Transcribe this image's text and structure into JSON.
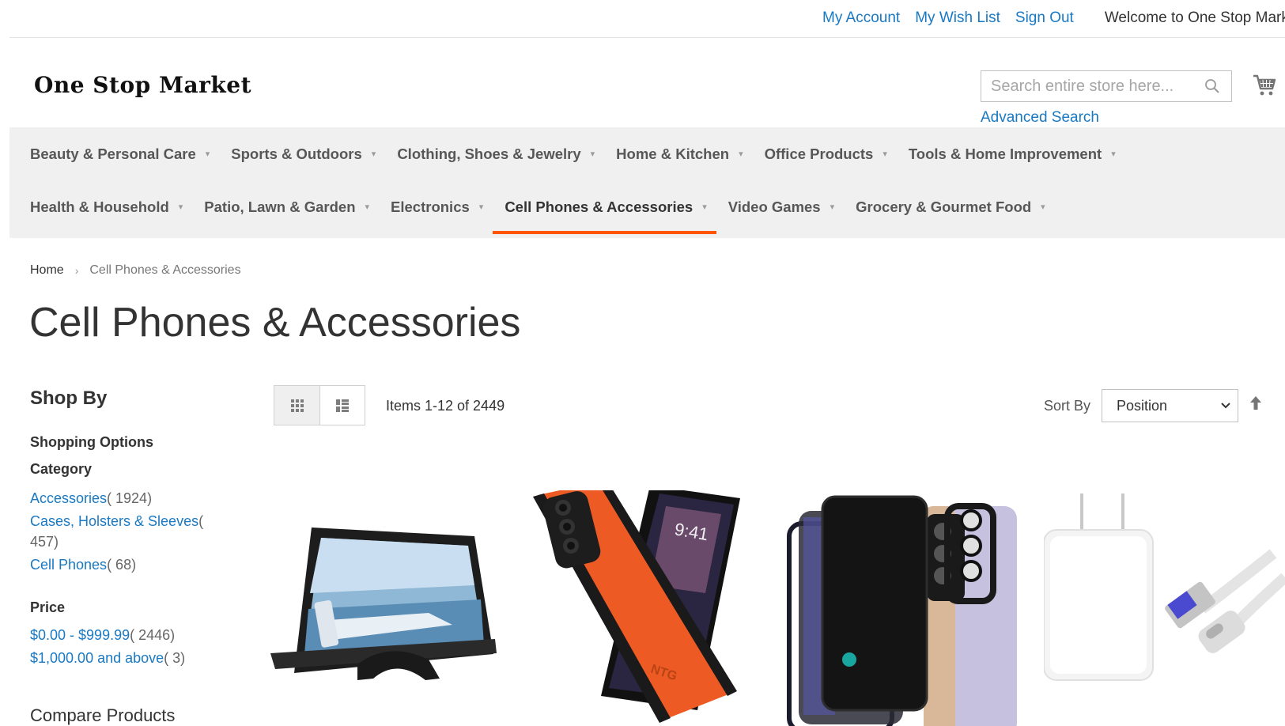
{
  "header": {
    "links": [
      "My Account",
      "My Wish List",
      "Sign Out"
    ],
    "welcome": "Welcome to One Stop Market"
  },
  "logo": "One Stop Market",
  "search": {
    "placeholder": "Search entire store here...",
    "advanced": "Advanced Search"
  },
  "nav": {
    "row1": [
      "Beauty & Personal Care",
      "Sports & Outdoors",
      "Clothing, Shoes & Jewelry",
      "Home & Kitchen",
      "Office Products",
      "Tools & Home Improvement"
    ],
    "row2": [
      "Health & Household",
      "Patio, Lawn & Garden",
      "Electronics",
      "Cell Phones & Accessories",
      "Video Games",
      "Grocery & Gourmet Food"
    ],
    "active": "Cell Phones & Accessories",
    "active_color": "#ff5501"
  },
  "breadcrumb": {
    "home": "Home",
    "current": "Cell Phones & Accessories"
  },
  "page_title": "Cell Phones & Accessories",
  "sidebar": {
    "shop_by": "Shop By",
    "shopping_options": "Shopping Options",
    "category_title": "Category",
    "categories": [
      {
        "label": "Accessories",
        "count": "( 1924)"
      },
      {
        "label": "Cases, Holsters & Sleeves",
        "count": "( 457)"
      },
      {
        "label": "Cell Phones",
        "count": "( 68)"
      }
    ],
    "price_title": "Price",
    "prices": [
      {
        "label": "$0.00 - $999.99",
        "count": "( 2446)"
      },
      {
        "label": "$1,000.00 and above",
        "count": "( 3)"
      }
    ],
    "compare": "Compare Products"
  },
  "toolbar": {
    "items": "Items 1-12 of 2449",
    "sort_label": "Sort By",
    "sort_value": "Position"
  },
  "products": [
    {
      "icon": "phone-screen-magnifier-image"
    },
    {
      "icon": "orange-phone-case-image"
    },
    {
      "icon": "privacy-screen-protector-image"
    },
    {
      "icon": "usb-c-charger-image"
    }
  ],
  "colors": {
    "link": "#1979c3",
    "accent": "#ff5501",
    "nav_bg": "#f0f0f0"
  }
}
